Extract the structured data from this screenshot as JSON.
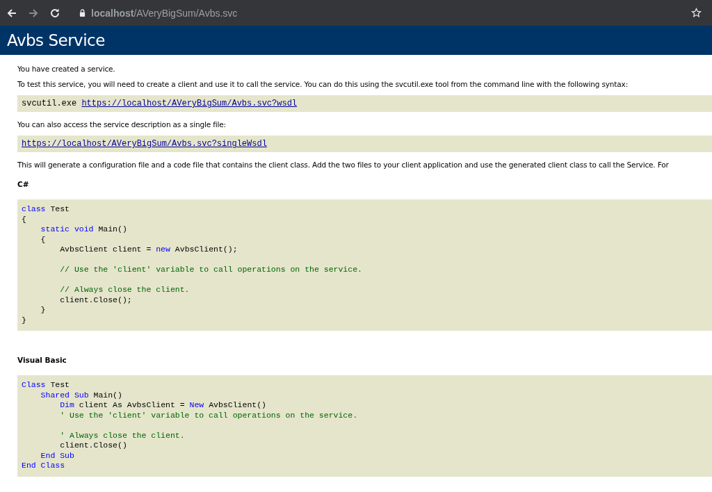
{
  "browser": {
    "address": "**localhost**/AVeryBigSum/Avbs.svc"
  },
  "page": {
    "title": "Avbs Service"
  },
  "content": [
    {
      "kind": "para",
      "text": "You have created a service."
    },
    {
      "kind": "para",
      "text": "To test this service, you will need to create a client and use it to call the service. You can do this using the svcutil.exe tool from the command line with the following syntax:"
    },
    {
      "kind": "command",
      "prefix": "svcutil.exe",
      "link": "https://localhost/AVeryBigSum/Avbs.svc?wsdl"
    },
    {
      "kind": "para",
      "text": "You can also access the service description as a single file:"
    },
    {
      "kind": "command",
      "link": "https://localhost/AVeryBigSum/Avbs.svc?singleWsdl"
    },
    {
      "kind": "para",
      "text": "This will generate a configuration file and a code file that contains the client class. Add the two files to your client application and use the generated client class to call the Service. For"
    },
    {
      "kind": "heading",
      "text": "C#"
    },
    {
      "kind": "code",
      "lines": [
        {
          "kind": "code",
          "tokens": [
            {
              "kind": "keyword",
              "text": "class"
            },
            {
              "kind": "plain",
              "text": " Test"
            }
          ]
        },
        {
          "kind": "code",
          "tokens": [
            {
              "kind": "plain",
              "text": "{"
            }
          ],
          "children": [
            {
              "kind": "code",
              "tokens": [
                {
                  "kind": "keyword",
                  "text": "static void"
                },
                {
                  "kind": "plain",
                  "text": " Main()"
                }
              ]
            },
            {
              "kind": "code",
              "tokens": [
                {
                  "kind": "plain",
                  "text": "{"
                }
              ],
              "children": [
                {
                  "kind": "code",
                  "tokens": [
                    {
                      "kind": "plain",
                      "text": "AvbsClient client = "
                    },
                    {
                      "kind": "keyword",
                      "text": "new"
                    },
                    {
                      "kind": "plain",
                      "text": " AvbsClient();"
                    }
                  ]
                },
                {
                  "kind": "blank"
                },
                {
                  "kind": "code",
                  "tokens": [
                    {
                      "kind": "comment",
                      "text": "// Use the 'client' variable to call operations on the service."
                    }
                  ]
                },
                {
                  "kind": "blank"
                },
                {
                  "kind": "code",
                  "tokens": [
                    {
                      "kind": "comment",
                      "text": "// Always close the client."
                    }
                  ]
                },
                {
                  "kind": "code",
                  "tokens": [
                    {
                      "kind": "plain",
                      "text": "client.Close();"
                    }
                  ]
                }
              ]
            },
            {
              "kind": "code",
              "tokens": [
                {
                  "kind": "plain",
                  "text": "}"
                }
              ]
            }
          ]
        },
        {
          "kind": "code",
          "tokens": [
            {
              "kind": "plain",
              "text": "}"
            }
          ]
        }
      ]
    },
    {
      "kind": "heading",
      "text": "Visual Basic"
    },
    {
      "kind": "code",
      "lines": [
        {
          "kind": "code",
          "tokens": [
            {
              "kind": "keyword",
              "text": "Class"
            },
            {
              "kind": "plain",
              "text": " Test"
            }
          ],
          "children": [
            {
              "kind": "code",
              "tokens": [
                {
                  "kind": "keyword",
                  "text": "Shared Sub"
                },
                {
                  "kind": "plain",
                  "text": " Main()"
                }
              ],
              "children": [
                {
                  "kind": "code",
                  "tokens": [
                    {
                      "kind": "keyword",
                      "text": "Dim"
                    },
                    {
                      "kind": "plain",
                      "text": " client As AvbsClient = "
                    },
                    {
                      "kind": "keyword",
                      "text": "New"
                    },
                    {
                      "kind": "plain",
                      "text": " AvbsClient()"
                    }
                  ]
                },
                {
                  "kind": "code",
                  "tokens": [
                    {
                      "kind": "comment",
                      "text": "' Use the 'client' variable to call operations on the service."
                    }
                  ]
                },
                {
                  "kind": "blank"
                },
                {
                  "kind": "code",
                  "tokens": [
                    {
                      "kind": "comment",
                      "text": "' Always close the client."
                    }
                  ]
                },
                {
                  "kind": "code",
                  "tokens": [
                    {
                      "kind": "plain",
                      "text": "client.Close()"
                    }
                  ]
                }
              ]
            },
            {
              "kind": "code",
              "tokens": [
                {
                  "kind": "keyword",
                  "text": "End Sub"
                }
              ]
            }
          ]
        },
        {
          "kind": "code",
          "tokens": [
            {
              "kind": "keyword",
              "text": "End Class"
            }
          ]
        }
      ]
    }
  ]
}
